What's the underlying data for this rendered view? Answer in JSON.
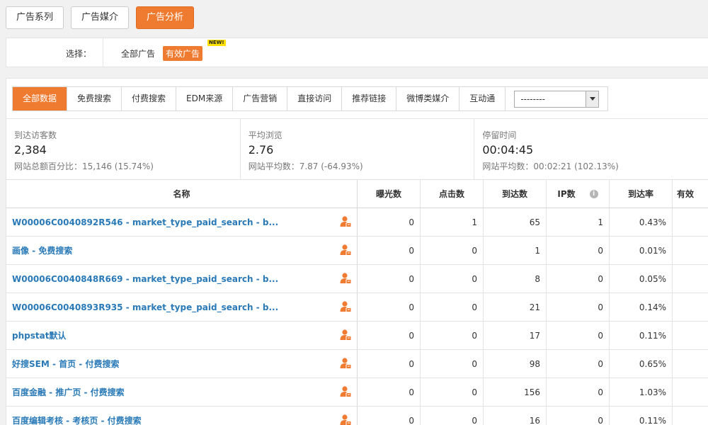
{
  "top_tabs": [
    {
      "label": "广告系列"
    },
    {
      "label": "广告媒介"
    },
    {
      "label": "广告分析"
    }
  ],
  "filter": {
    "label": "选择：",
    "options": [
      "全部广告",
      "有效广告"
    ],
    "selected": "有效广告",
    "new_badge": "NEW!"
  },
  "source_tabs": [
    "全部数据",
    "免费搜索",
    "付费搜索",
    "EDM来源",
    "广告营销",
    "直接访问",
    "推荐链接",
    "微博类媒介",
    "互动通"
  ],
  "source_tab_active": "全部数据",
  "source_select": {
    "value": "--------"
  },
  "stats": [
    {
      "label": "到达访客数",
      "value": "2,384",
      "sub": "网站总额百分比：15,146 (15.74%)"
    },
    {
      "label": "平均浏览",
      "value": "2.76",
      "sub": "网站平均数：7.87 (-64.93%)"
    },
    {
      "label": "停留时间",
      "value": "00:04:45",
      "sub": "网站平均数：00:02:21 (102.13%)"
    }
  ],
  "table": {
    "columns": [
      "名称",
      "曝光数",
      "点击数",
      "到达数",
      "IP数",
      "到达率",
      "有效"
    ],
    "rows": [
      {
        "name": "W00006C0040892R546 - market_type_paid_search - b...",
        "imp": "0",
        "clicks": "1",
        "arrive": "65",
        "ip": "1",
        "rate": "0.43%"
      },
      {
        "name": "画像 - 免费搜索",
        "imp": "0",
        "clicks": "0",
        "arrive": "1",
        "ip": "0",
        "rate": "0.01%"
      },
      {
        "name": "W00006C0040848R669 - market_type_paid_search - b...",
        "imp": "0",
        "clicks": "0",
        "arrive": "8",
        "ip": "0",
        "rate": "0.05%"
      },
      {
        "name": "W00006C0040893R935 - market_type_paid_search - b...",
        "imp": "0",
        "clicks": "0",
        "arrive": "21",
        "ip": "0",
        "rate": "0.14%"
      },
      {
        "name": "phpstat默认",
        "imp": "0",
        "clicks": "0",
        "arrive": "17",
        "ip": "0",
        "rate": "0.11%"
      },
      {
        "name": "好搜SEM - 首页 - 付费搜索",
        "imp": "0",
        "clicks": "0",
        "arrive": "98",
        "ip": "0",
        "rate": "0.65%"
      },
      {
        "name": "百度金融 - 推广页 - 付费搜索",
        "imp": "0",
        "clicks": "0",
        "arrive": "156",
        "ip": "0",
        "rate": "1.03%"
      },
      {
        "name": "百度编辑考核 - 考核页 - 付费搜索",
        "imp": "0",
        "clicks": "0",
        "arrive": "16",
        "ip": "0",
        "rate": "0.11%"
      }
    ]
  },
  "colors": {
    "accent": "#ef7b31",
    "link": "#2a7ab8"
  },
  "icons": {
    "row_action": "person-icon",
    "ip_info": "info-icon",
    "select_arrow": "chevron-down-icon"
  }
}
